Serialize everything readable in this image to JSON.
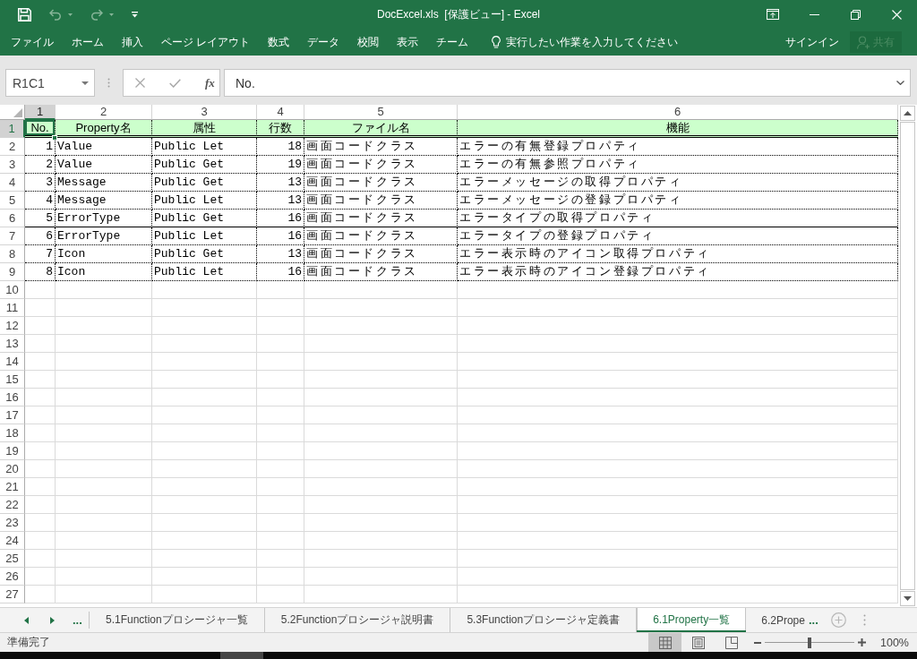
{
  "window": {
    "title": "DocExcel.xls  [保護ビュー] - Excel"
  },
  "quick_access": [
    {
      "kind": "save",
      "disabled": false
    },
    {
      "kind": "undo",
      "disabled": true
    },
    {
      "kind": "redo",
      "disabled": true
    },
    {
      "kind": "customize",
      "disabled": false
    }
  ],
  "ribbon_tabs": [
    "ファイル",
    "ホーム",
    "挿入",
    "ページ レイアウト",
    "数式",
    "データ",
    "校閲",
    "表示",
    "チーム"
  ],
  "tell_me": {
    "placeholder": "実行したい作業を入力してください"
  },
  "account": {
    "sign_in": "サインイン",
    "share": {
      "label": "共有",
      "disabled": true
    }
  },
  "formula_bar": {
    "name_box": "R1C1",
    "function_label": "fx",
    "value": "No."
  },
  "sheet": {
    "column_headers": [
      {
        "label": "1",
        "selected": true
      },
      {
        "label": "2",
        "selected": false
      },
      {
        "label": "3",
        "selected": false
      },
      {
        "label": "4",
        "selected": false
      },
      {
        "label": "5",
        "selected": false
      },
      {
        "label": "6",
        "selected": false
      }
    ],
    "row_headers": [
      {
        "label": "1",
        "selected": true
      },
      {
        "label": "2",
        "selected": false
      },
      {
        "label": "3",
        "selected": false
      },
      {
        "label": "4",
        "selected": false
      },
      {
        "label": "5",
        "selected": false
      },
      {
        "label": "6",
        "selected": false
      },
      {
        "label": "7",
        "selected": false
      },
      {
        "label": "8",
        "selected": false
      },
      {
        "label": "9",
        "selected": false
      },
      {
        "label": "10",
        "selected": false
      },
      {
        "label": "11",
        "selected": false
      },
      {
        "label": "12",
        "selected": false
      },
      {
        "label": "13",
        "selected": false
      },
      {
        "label": "14",
        "selected": false
      },
      {
        "label": "15",
        "selected": false
      },
      {
        "label": "16",
        "selected": false
      },
      {
        "label": "17",
        "selected": false
      },
      {
        "label": "18",
        "selected": false
      },
      {
        "label": "19",
        "selected": false
      },
      {
        "label": "20",
        "selected": false
      },
      {
        "label": "21",
        "selected": false
      },
      {
        "label": "22",
        "selected": false
      },
      {
        "label": "23",
        "selected": false
      },
      {
        "label": "24",
        "selected": false
      },
      {
        "label": "25",
        "selected": false
      },
      {
        "label": "26",
        "selected": false
      },
      {
        "label": "27",
        "selected": false
      }
    ],
    "rows": [
      {
        "kind": "header",
        "rule_below": true,
        "cells": [
          "No.",
          "Property名",
          "属性",
          "行数",
          "ファイル名",
          "機能"
        ]
      },
      {
        "kind": "data",
        "rule_below": false,
        "cells": [
          "1",
          "Value",
          "Public Let",
          "18",
          "画面コードクラス",
          "エラーの有無登録プロパティ"
        ]
      },
      {
        "kind": "data",
        "rule_below": false,
        "cells": [
          "2",
          "Value",
          "Public Get",
          "19",
          "画面コードクラス",
          "エラーの有無参照プロパティ"
        ]
      },
      {
        "kind": "data",
        "rule_below": false,
        "cells": [
          "3",
          "Message",
          "Public Get",
          "13",
          "画面コードクラス",
          "エラーメッセージの取得プロパティ"
        ]
      },
      {
        "kind": "data",
        "rule_below": false,
        "cells": [
          "4",
          "Message",
          "Public Let",
          "13",
          "画面コードクラス",
          "エラーメッセージの登録プロパティ"
        ]
      },
      {
        "kind": "data",
        "rule_below": true,
        "cells": [
          "5",
          "ErrorType",
          "Public Get",
          "16",
          "画面コードクラス",
          "エラータイプの取得プロパティ"
        ]
      },
      {
        "kind": "data",
        "rule_below": false,
        "cells": [
          "6",
          "ErrorType",
          "Public Let",
          "16",
          "画面コードクラス",
          "エラータイプの登録プロパティ"
        ]
      },
      {
        "kind": "data",
        "rule_below": false,
        "cells": [
          "7",
          "Icon",
          "Public Get",
          "13",
          "画面コードクラス",
          "エラー表示時のアイコン取得プロパティ"
        ]
      },
      {
        "kind": "data",
        "rule_below": false,
        "cells": [
          "8",
          "Icon",
          "Public Let",
          "16",
          "画面コードクラス",
          "エラー表示時のアイコン登録プロパティ"
        ]
      }
    ]
  },
  "sheet_tabs": {
    "overflow_left": "...",
    "tabs": [
      {
        "label": "5.1Functionプロシージャ一覧",
        "selected": false
      },
      {
        "label": "5.2Functionプロシージャ説明書",
        "selected": false
      },
      {
        "label": "5.3Functionプロシージャ定義書",
        "selected": false
      },
      {
        "label": "6.1Property一覧",
        "selected": true
      },
      {
        "label": "6.2Prope",
        "selected": false
      }
    ],
    "overflow_right": "..."
  },
  "status_bar": {
    "text": "準備完了",
    "views": [
      {
        "kind": "normal",
        "selected": true
      },
      {
        "kind": "page_layout",
        "selected": false
      },
      {
        "kind": "page_break_preview",
        "selected": false
      }
    ],
    "zoom": {
      "level": 0.5,
      "reading": "100%"
    }
  }
}
